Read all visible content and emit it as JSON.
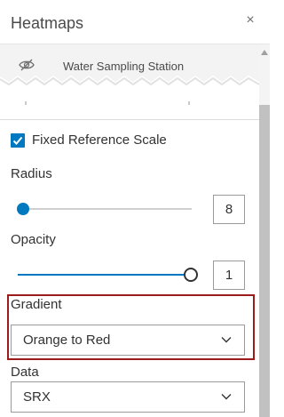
{
  "header": {
    "title": "Heatmaps",
    "close_glyph": "×"
  },
  "layer": {
    "name": "Water Sampling Station",
    "visibility_icon": "eye-slash-icon"
  },
  "fixed_scale": {
    "label": "Fixed Reference Scale",
    "checked": true
  },
  "radius": {
    "label": "Radius",
    "value": "8",
    "slider_level": 0
  },
  "opacity": {
    "label": "Opacity",
    "value": "1",
    "slider_level": 1
  },
  "gradient": {
    "label": "Gradient",
    "selected": "Orange to Red"
  },
  "data_field": {
    "label": "Data",
    "selected": "SRX"
  },
  "colors": {
    "accent": "#0079c1",
    "highlight": "#9e1b1b"
  }
}
